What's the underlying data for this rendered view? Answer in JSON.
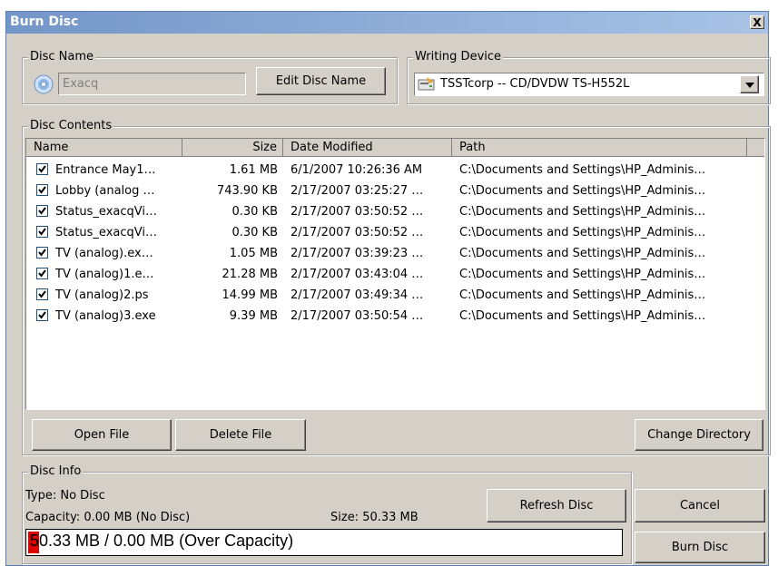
{
  "window": {
    "title": "Burn Disc",
    "close_label": "X"
  },
  "disc_name": {
    "legend": "Disc Name",
    "value": "Exacq",
    "edit_label": "Edit Disc Name"
  },
  "writing_device": {
    "legend": "Writing Device",
    "selected": "TSSTcorp -- CD/DVDW TS-H552L"
  },
  "contents": {
    "legend": "Disc Contents",
    "columns": {
      "name": "Name",
      "size": "Size",
      "date": "Date Modified",
      "path": "Path"
    },
    "rows": [
      {
        "name": "Entrance May1…",
        "size": "1.61 MB",
        "date": "6/1/2007 10:26:36 AM",
        "path": "C:\\Documents and Settings\\HP_Adminis…",
        "checked": true
      },
      {
        "name": "Lobby (analog …",
        "size": "743.90 KB",
        "date": "2/17/2007 03:25:27 …",
        "path": "C:\\Documents and Settings\\HP_Adminis…",
        "checked": true
      },
      {
        "name": "Status_exacqVi…",
        "size": "0.30 KB",
        "date": "2/17/2007 03:50:52 …",
        "path": "C:\\Documents and Settings\\HP_Adminis…",
        "checked": true
      },
      {
        "name": "Status_exacqVi…",
        "size": "0.30 KB",
        "date": "2/17/2007 03:50:52 …",
        "path": "C:\\Documents and Settings\\HP_Adminis…",
        "checked": true
      },
      {
        "name": "TV (analog).ex…",
        "size": "1.05 MB",
        "date": "2/17/2007 03:39:23 …",
        "path": "C:\\Documents and Settings\\HP_Adminis…",
        "checked": true
      },
      {
        "name": "TV (analog)1.e…",
        "size": "21.28 MB",
        "date": "2/17/2007 03:43:04 …",
        "path": "C:\\Documents and Settings\\HP_Adminis…",
        "checked": true
      },
      {
        "name": "TV (analog)2.ps",
        "size": "14.99 MB",
        "date": "2/17/2007 03:49:34 …",
        "path": "C:\\Documents and Settings\\HP_Adminis…",
        "checked": true
      },
      {
        "name": "TV (analog)3.exe",
        "size": "9.39 MB",
        "date": "2/17/2007 03:50:54 …",
        "path": "C:\\Documents and Settings\\HP_Adminis…",
        "checked": true
      }
    ],
    "open_label": "Open File",
    "delete_label": "Delete File",
    "change_dir_label": "Change Directory"
  },
  "disc_info": {
    "legend": "Disc Info",
    "type": "Type: No Disc",
    "capacity": "Capacity: 0.00 MB (No Disc)",
    "size": "Size: 50.33 MB",
    "refresh_label": "Refresh Disc",
    "progress_text": "50.33 MB / 0.00 MB (Over Capacity)",
    "progress_fill_fraction": 0.018
  },
  "actions": {
    "cancel_label": "Cancel",
    "burn_label": "Burn Disc"
  },
  "colors": {
    "title_bar": "#7396c8",
    "progress_fill": "#e00000",
    "checkbox_border": "#1c5180"
  }
}
